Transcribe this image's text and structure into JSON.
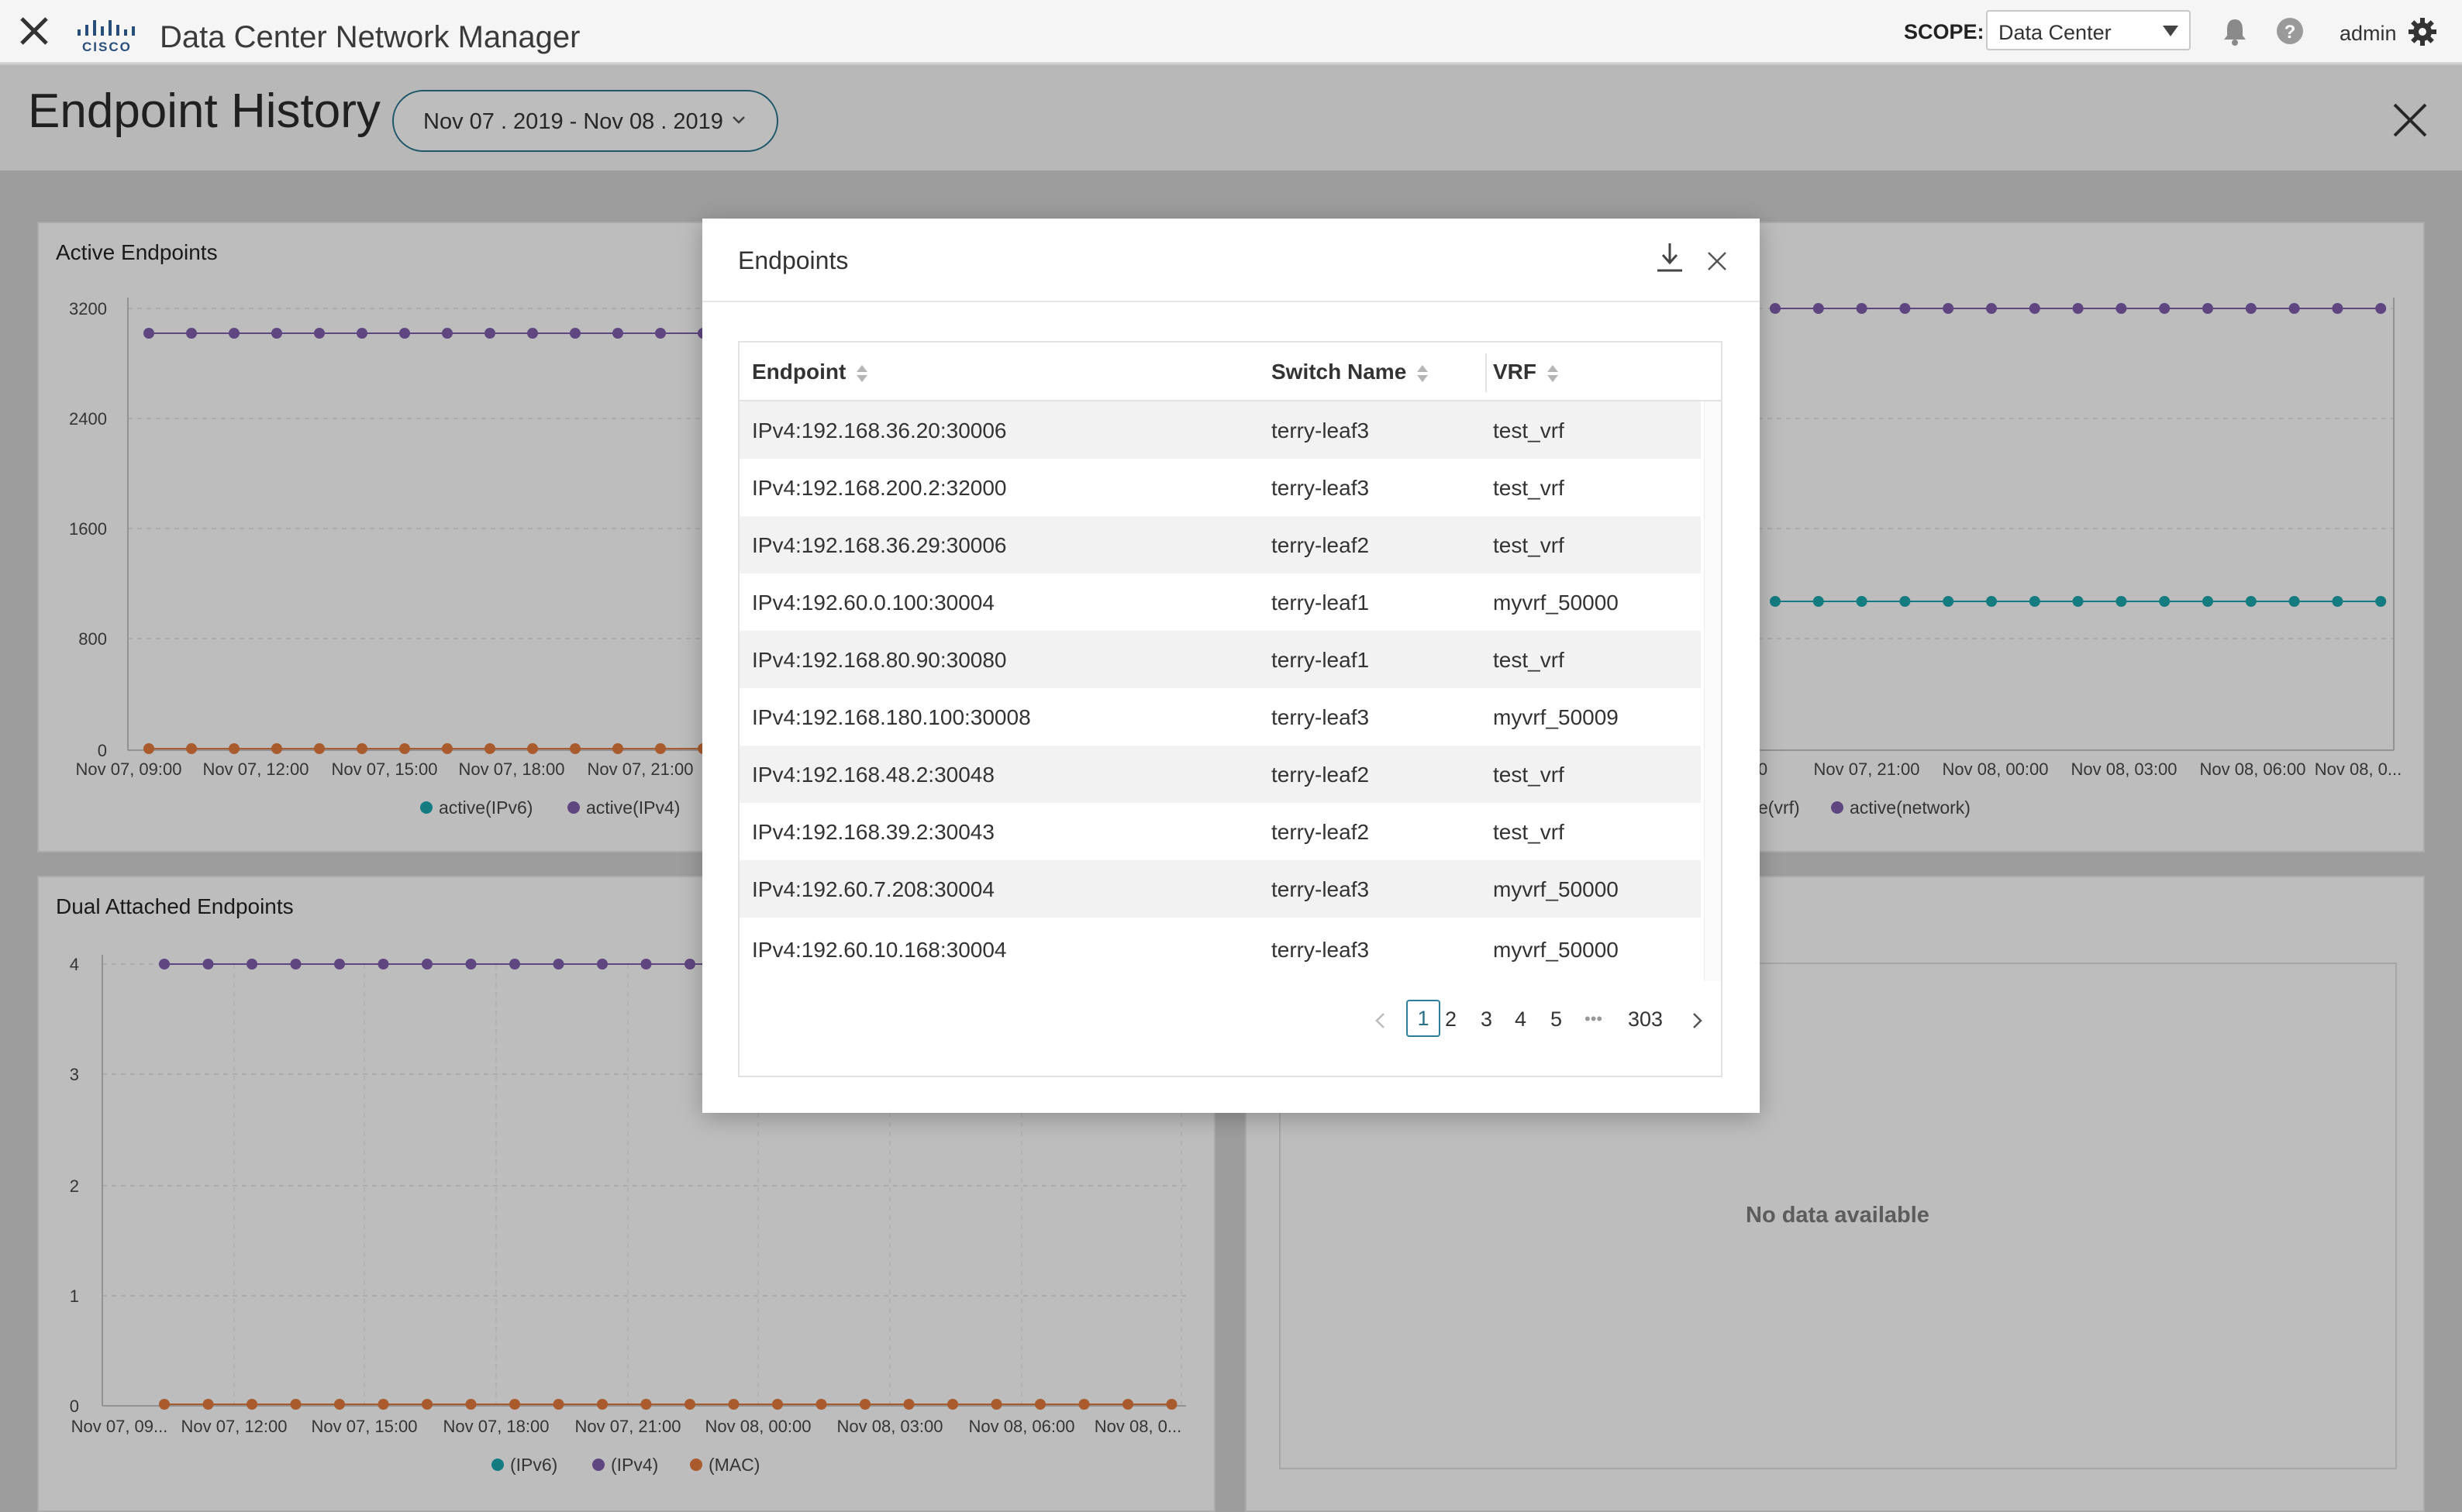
{
  "topbar": {
    "app_title": "Data Center Network Manager",
    "scope_label": "SCOPE:",
    "scope_value": "Data Center",
    "user": "admin"
  },
  "page": {
    "title": "Endpoint History",
    "date_range": "Nov 07 . 2019 - Nov 08 . 2019"
  },
  "cards": {
    "active_endpoints": {
      "title": "Active Endpoints",
      "y_ticks": [
        "3200",
        "2400",
        "1600",
        "800",
        "0"
      ],
      "x_ticks": [
        "Nov 07, 09:00",
        "Nov 07, 12:00",
        "Nov 07, 15:00",
        "Nov 07, 18:00",
        "Nov 07, 21:00"
      ],
      "legend": [
        "active(IPv6)",
        "active(IPv4)"
      ]
    },
    "active_right": {
      "x_ticks": [
        "0",
        "Nov 07, 21:00",
        "Nov 08, 00:00",
        "Nov 08, 03:00",
        "Nov 08, 06:00",
        "Nov 08, 0..."
      ],
      "legend": [
        "e(vrf)",
        "active(network)"
      ]
    },
    "dual_attached": {
      "title": "Dual Attached Endpoints",
      "y_ticks": [
        "4",
        "3",
        "2",
        "1",
        "0"
      ],
      "x_ticks": [
        "Nov 07, 09...",
        "Nov 07, 12:00",
        "Nov 07, 15:00",
        "Nov 07, 18:00",
        "Nov 07, 21:00",
        "Nov 08, 00:00",
        "Nov 08, 03:00",
        "Nov 08, 06:00",
        "Nov 08, 0..."
      ],
      "legend": [
        "(IPv6)",
        "(IPv4)",
        "(MAC)"
      ]
    },
    "empty_card": {
      "message": "No data available"
    }
  },
  "modal": {
    "title": "Endpoints",
    "columns": [
      "Endpoint",
      "Switch Name",
      "VRF"
    ],
    "rows": [
      [
        "IPv4:192.168.36.20:30006",
        "terry-leaf3",
        "test_vrf"
      ],
      [
        "IPv4:192.168.200.2:32000",
        "terry-leaf3",
        "test_vrf"
      ],
      [
        "IPv4:192.168.36.29:30006",
        "terry-leaf2",
        "test_vrf"
      ],
      [
        "IPv4:192.60.0.100:30004",
        "terry-leaf1",
        "myvrf_50000"
      ],
      [
        "IPv4:192.168.80.90:30080",
        "terry-leaf1",
        "test_vrf"
      ],
      [
        "IPv4:192.168.180.100:30008",
        "terry-leaf3",
        "myvrf_50009"
      ],
      [
        "IPv4:192.168.48.2:30048",
        "terry-leaf2",
        "test_vrf"
      ],
      [
        "IPv4:192.168.39.2:30043",
        "terry-leaf2",
        "test_vrf"
      ],
      [
        "IPv4:192.60.7.208:30004",
        "terry-leaf3",
        "myvrf_50000"
      ],
      [
        "IPv4:192.60.10.168:30004",
        "terry-leaf3",
        "myvrf_50000"
      ]
    ],
    "pagination": {
      "pages": [
        "1",
        "2",
        "3",
        "4",
        "5"
      ],
      "ellipsis": "•••",
      "last_page": "303",
      "current": "1"
    }
  },
  "colors": {
    "ipv6": "#1a9fa6",
    "ipv4": "#7a5aa6",
    "mac": "#d9753a",
    "accent": "#2a6f86"
  }
}
